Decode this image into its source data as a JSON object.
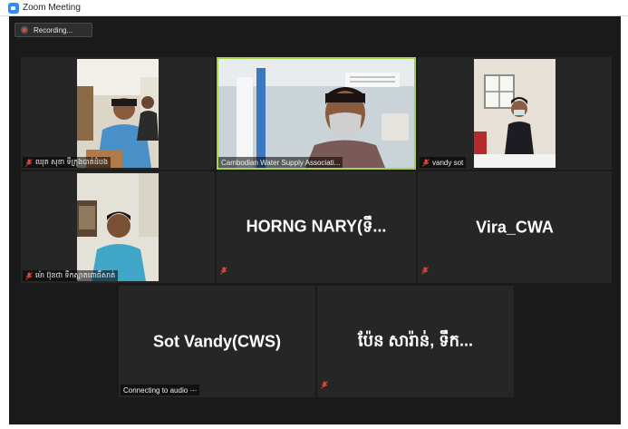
{
  "window": {
    "title": "Zoom Meeting"
  },
  "recording": {
    "label": "Recording..."
  },
  "participants": [
    {
      "name": "ឈុត សុខា ទីក្រុងបាត់ដំបង",
      "muted": true,
      "video": true
    },
    {
      "name": "Cambodian Water Supply Associati...",
      "muted": false,
      "video": true,
      "active_speaker": true
    },
    {
      "name": "vandy sot",
      "muted": true,
      "video": true
    },
    {
      "name": "ម៉ោ ប៊ុនថា ទឹកស្អាតពោធិ៍សាត់",
      "muted": true,
      "video": true
    },
    {
      "display_name": "HORNG  NARY(ទឹ...",
      "muted": true,
      "video": false
    },
    {
      "display_name": "Vira_CWA",
      "muted": true,
      "video": false
    },
    {
      "display_name": "Sot Vandy(CWS)",
      "status": "Connecting to audio ·‑·",
      "muted": false,
      "video": false
    },
    {
      "display_name": "ប៉ែន សារ៉ាន់, ទឹក...",
      "muted": true,
      "video": false
    }
  ],
  "colors": {
    "active_border": "#a6d24a",
    "mute_icon": "#e8463c",
    "brand": "#2d8cff"
  }
}
